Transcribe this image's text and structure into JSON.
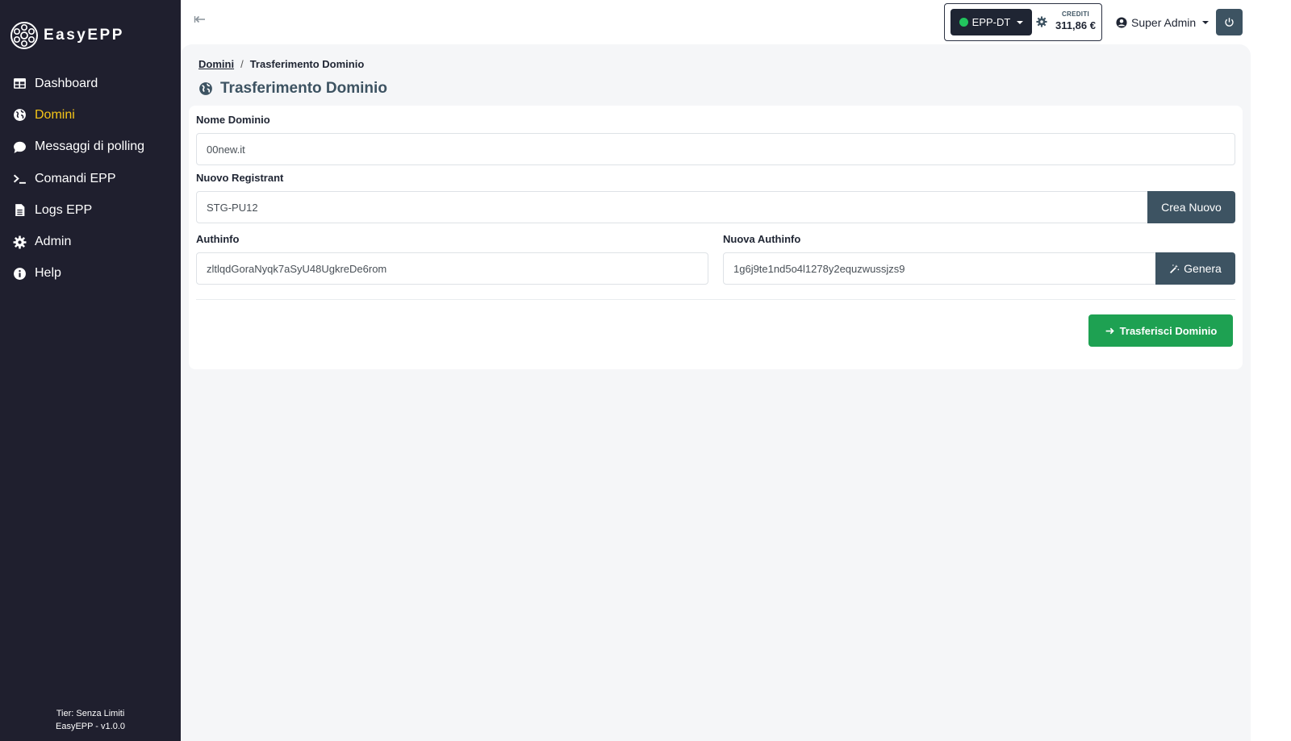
{
  "brand": {
    "name": "EasyEPP"
  },
  "sidebar": {
    "items": [
      {
        "label": "Dashboard",
        "icon": "table-icon"
      },
      {
        "label": "Domini",
        "icon": "globe-icon",
        "active": true
      },
      {
        "label": "Messaggi di polling",
        "icon": "chat-bubble-icon"
      },
      {
        "label": "Comandi EPP",
        "icon": "terminal-icon"
      },
      {
        "label": "Logs EPP",
        "icon": "file-icon"
      },
      {
        "label": "Admin",
        "icon": "gear-icon"
      },
      {
        "label": "Help",
        "icon": "info-icon"
      }
    ],
    "footer": {
      "tier": "Tier: Senza Limiti",
      "version": "EasyEPP - v1.0.0"
    }
  },
  "topbar": {
    "environment": {
      "label": "EPP-DT",
      "status_color": "#22c55e"
    },
    "credits": {
      "label": "CREDITI",
      "value": "311,86 €"
    },
    "user": {
      "label": "Super Admin"
    }
  },
  "breadcrumb": {
    "parent": "Domini",
    "separator": "/",
    "current": "Trasferimento Dominio"
  },
  "page": {
    "title": "Trasferimento Dominio"
  },
  "form": {
    "domain_name": {
      "label": "Nome Dominio",
      "value": "00new.it"
    },
    "new_registrant": {
      "label": "Nuovo Registrant",
      "value": "STG-PU12",
      "button": "Crea Nuovo"
    },
    "authinfo": {
      "label": "Authinfo",
      "value": "zltlqdGoraNyqk7aSyU48UgkreDe6rom"
    },
    "new_authinfo": {
      "label": "Nuova Authinfo",
      "value": "1g6j9te1nd5o4l1278y2equzwussjzs9",
      "button": "Genera"
    },
    "submit": {
      "label": "Trasferisci Dominio"
    }
  },
  "colors": {
    "sidebar_bg": "#1f1f2e",
    "active_nav": "#f5c518",
    "primary_dark": "#3d5362",
    "success": "#1ea152"
  }
}
